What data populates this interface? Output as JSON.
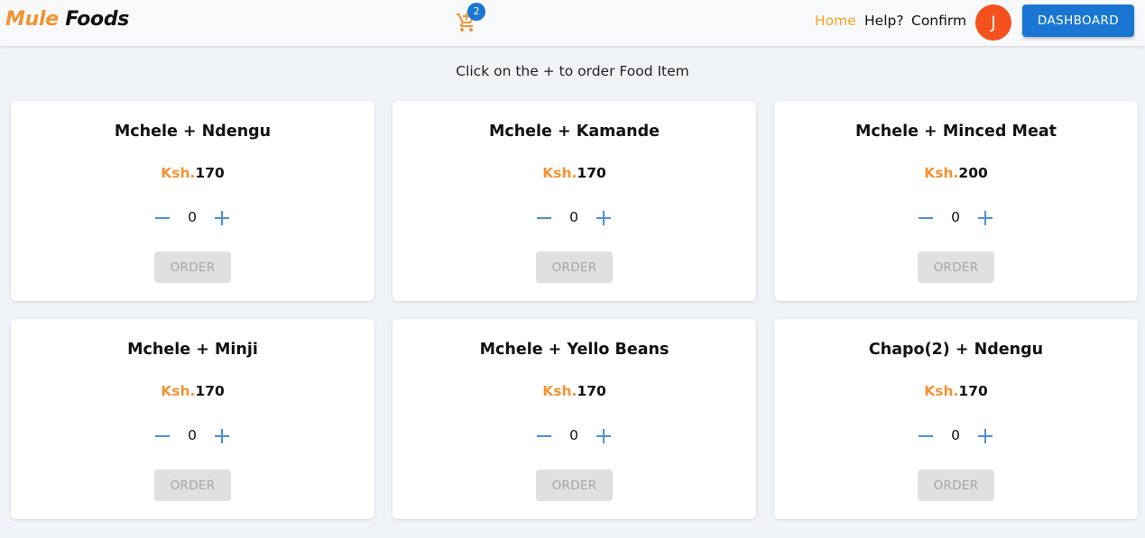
{
  "brand": {
    "part1": "Mule",
    "part2": "Foods"
  },
  "cart": {
    "icon": "cart-icon",
    "count": "2"
  },
  "nav": {
    "home": "Home",
    "help": "Help?",
    "confirm": "Confirm"
  },
  "avatar": {
    "initial": "J"
  },
  "dashboard_label": "DASHBOARD",
  "instruction": "Click on the + to order Food Item",
  "currency": "Ksh.",
  "colors": {
    "accent": "#f39333",
    "primary": "#1976d2",
    "avatar": "#f4511e",
    "active_nav": "#f5a623"
  },
  "items": [
    {
      "name": "Mchele + Ndengu",
      "price": "170",
      "qty": "0",
      "order": "ORDER"
    },
    {
      "name": "Mchele + Kamande",
      "price": "170",
      "qty": "0",
      "order": "ORDER"
    },
    {
      "name": "Mchele + Minced Meat",
      "price": "200",
      "qty": "0",
      "order": "ORDER"
    },
    {
      "name": "Mchele + Minji",
      "price": "170",
      "qty": "0",
      "order": "ORDER"
    },
    {
      "name": "Mchele + Yello Beans",
      "price": "170",
      "qty": "0",
      "order": "ORDER"
    },
    {
      "name": "Chapo(2) + Ndengu",
      "price": "170",
      "qty": "0",
      "order": "ORDER"
    }
  ]
}
